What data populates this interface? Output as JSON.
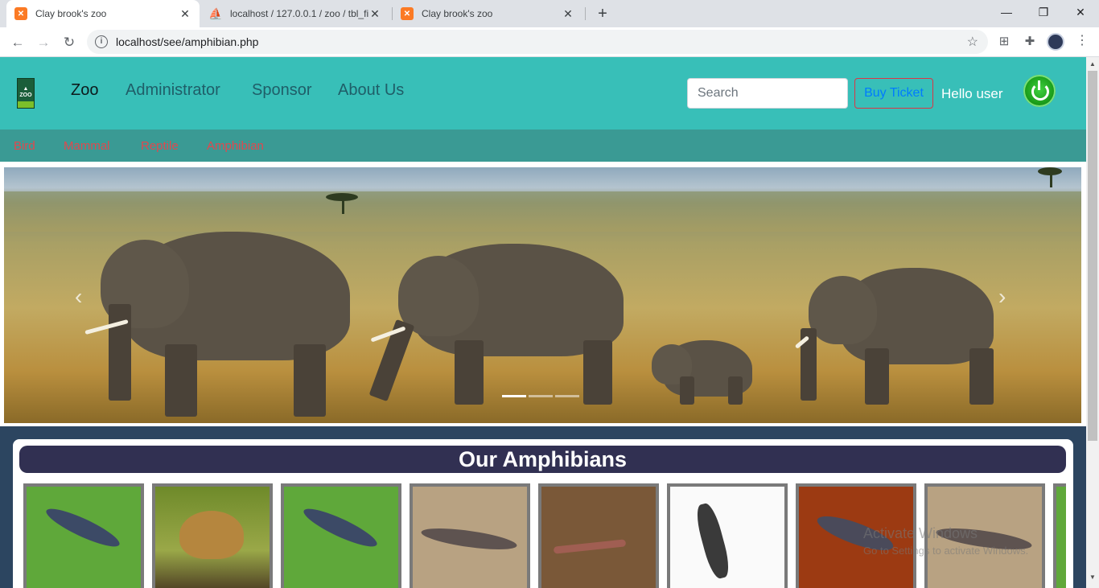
{
  "browser": {
    "tabs": [
      {
        "title": "Clay brook's zoo",
        "active": true
      },
      {
        "title": "localhost / 127.0.0.1 / zoo / tbl_fi",
        "active": false
      },
      {
        "title": "Clay brook's zoo",
        "active": false
      }
    ],
    "url": "localhost/see/amphibian.php"
  },
  "nav": {
    "brand": "Zoo",
    "links": [
      "Administrator",
      "Sponsor",
      "About Us"
    ],
    "search_placeholder": "Search",
    "buy_ticket": "Buy Ticket",
    "greeting": "Hello user"
  },
  "subnav": {
    "links": [
      "Bird",
      "Mammal",
      "Reptile",
      "Amphibian"
    ]
  },
  "carousel": {
    "slide_count": 3,
    "active_slide": 1
  },
  "section": {
    "title": "Our Amphibians"
  },
  "amphibians": [
    {
      "kind": "salamander-blue"
    },
    {
      "kind": "frog"
    },
    {
      "kind": "salamander-blue"
    },
    {
      "kind": "salamander-brown"
    },
    {
      "kind": "caecilian"
    },
    {
      "kind": "salamander-dark"
    },
    {
      "kind": "salamander-red"
    },
    {
      "kind": "salamander-brown"
    }
  ],
  "watermark": {
    "line1": "Activate Windows",
    "line2": "Go to Settings to activate Windows."
  },
  "colors": {
    "topnav": "#38bfb8",
    "subnav": "#3a9a94",
    "sublink": "#e0484e",
    "heading_bg": "#313052",
    "section_bg": "#2c4560"
  }
}
